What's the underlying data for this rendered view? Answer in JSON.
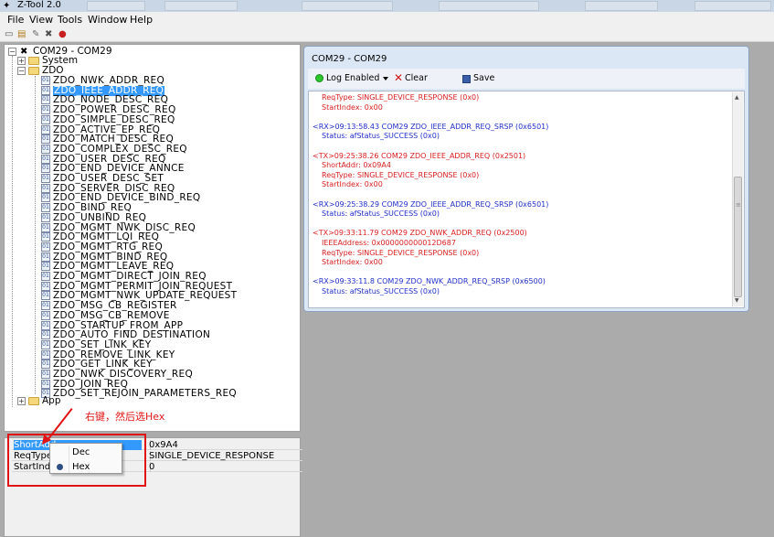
{
  "window": {
    "app_icon": "app-icon",
    "title": "Z-Tool 2.0",
    "accent": "#3399ff"
  },
  "menubar": {
    "items": [
      "File",
      "View",
      "Tools",
      "Window",
      "Help"
    ]
  },
  "toolbar": {
    "icons": [
      "open-icon",
      "save-icon",
      "connect-icon",
      "tools-icon",
      "record-icon"
    ]
  },
  "tree": {
    "root_label": "COM29 - COM29",
    "system_label": "System",
    "zdo_label": "ZDO",
    "app_label": "App",
    "selected_index": 1,
    "zdo_items": [
      "ZDO_NWK_ADDR_REQ",
      "ZDO_IEEE_ADDR_REQ",
      "ZDO_NODE_DESC_REQ",
      "ZDO_POWER_DESC_REQ",
      "ZDO_SIMPLE_DESC_REQ",
      "ZDO_ACTIVE_EP_REQ",
      "ZDO_MATCH_DESC_REQ",
      "ZDO_COMPLEX_DESC_REQ",
      "ZDO_USER_DESC_REQ",
      "ZDO_END_DEVICE_ANNCE",
      "ZDO_USER_DESC_SET",
      "ZDO_SERVER_DISC_REQ",
      "ZDO_END_DEVICE_BIND_REQ",
      "ZDO_BIND_REQ",
      "ZDO_UNBIND_REQ",
      "ZDO_MGMT_NWK_DISC_REQ",
      "ZDO_MGMT_LQI_REQ",
      "ZDO_MGMT_RTG_REQ",
      "ZDO_MGMT_BIND_REQ",
      "ZDO_MGMT_LEAVE_REQ",
      "ZDO_MGMT_DIRECT_JOIN_REQ",
      "ZDO_MGMT_PERMIT_JOIN_REQUEST",
      "ZDO_MGMT_NWK_UPDATE_REQUEST",
      "ZDO_MSG_CB_REGISTER",
      "ZDO_MSG_CB_REMOVE",
      "ZDO_STARTUP_FROM_APP",
      "ZDO_AUTO_FIND_DESTINATION",
      "ZDO_SET_LINK_KEY",
      "ZDO_REMOVE_LINK_KEY",
      "ZDO_GET_LINK_KEY",
      "ZDO_NWK_DISCOVERY_REQ",
      "ZDO_JOIN_REQ",
      "ZDO_SET_REJOIN_PARAMETERS_REQ"
    ]
  },
  "annotation": {
    "text": "右键，然后选Hex",
    "color": "#e01414"
  },
  "properties": {
    "rows": [
      {
        "name": "ShortAddr",
        "shown_name": "ShortAdd",
        "value": "0x9A4",
        "selected": true
      },
      {
        "name": "ReqType",
        "shown_name": "ReqType",
        "value": "SINGLE_DEVICE_RESPONSE",
        "selected": false
      },
      {
        "name": "StartIndex",
        "shown_name": "StartInde",
        "value": "0",
        "selected": false
      }
    ]
  },
  "context_menu": {
    "items": [
      {
        "label": "Dec",
        "checked": false
      },
      {
        "label": "Hex",
        "checked": true
      }
    ]
  },
  "log_window": {
    "title": "COM29 - COM29",
    "log_enabled_label": "Log Enabled",
    "clear_label": "Clear",
    "save_label": "Save",
    "colors": {
      "tx": "#d82020",
      "rx": "#2030c8",
      "enabled": "#2bc62b"
    },
    "lines": [
      {
        "kind": "tx",
        "indent": true,
        "text": "ReqType: SINGLE_DEVICE_RESPONSE (0x0)"
      },
      {
        "kind": "tx",
        "indent": true,
        "text": "StartIndex: 0x00"
      },
      {
        "kind": "blank",
        "indent": false,
        "text": ""
      },
      {
        "kind": "rx",
        "indent": false,
        "text": "<RX>09:13:58.43 COM29 ZDO_IEEE_ADDR_REQ_SRSP (0x6501)"
      },
      {
        "kind": "rx",
        "indent": true,
        "text": "Status: afStatus_SUCCESS (0x0)"
      },
      {
        "kind": "blank",
        "indent": false,
        "text": ""
      },
      {
        "kind": "tx",
        "indent": false,
        "text": "<TX>09:25:38.26 COM29 ZDO_IEEE_ADDR_REQ (0x2501)"
      },
      {
        "kind": "tx",
        "indent": true,
        "text": "ShortAddr: 0x09A4"
      },
      {
        "kind": "tx",
        "indent": true,
        "text": "ReqType: SINGLE_DEVICE_RESPONSE (0x0)"
      },
      {
        "kind": "tx",
        "indent": true,
        "text": "StartIndex: 0x00"
      },
      {
        "kind": "blank",
        "indent": false,
        "text": ""
      },
      {
        "kind": "rx",
        "indent": false,
        "text": "<RX>09:25:38.29 COM29 ZDO_IEEE_ADDR_REQ_SRSP (0x6501)"
      },
      {
        "kind": "rx",
        "indent": true,
        "text": "Status: afStatus_SUCCESS (0x0)"
      },
      {
        "kind": "blank",
        "indent": false,
        "text": ""
      },
      {
        "kind": "tx",
        "indent": false,
        "text": "<TX>09:33:11.79 COM29 ZDO_NWK_ADDR_REQ (0x2500)"
      },
      {
        "kind": "tx",
        "indent": true,
        "text": "IEEEAddress: 0x000000000012D687"
      },
      {
        "kind": "tx",
        "indent": true,
        "text": "ReqType: SINGLE_DEVICE_RESPONSE (0x0)"
      },
      {
        "kind": "tx",
        "indent": true,
        "text": "StartIndex: 0x00"
      },
      {
        "kind": "blank",
        "indent": false,
        "text": ""
      },
      {
        "kind": "rx",
        "indent": false,
        "text": "<RX>09:33:11.8 COM29 ZDO_NWK_ADDR_REQ_SRSP (0x6500)"
      },
      {
        "kind": "rx",
        "indent": true,
        "text": "Status: afStatus_SUCCESS (0x0)"
      }
    ]
  }
}
